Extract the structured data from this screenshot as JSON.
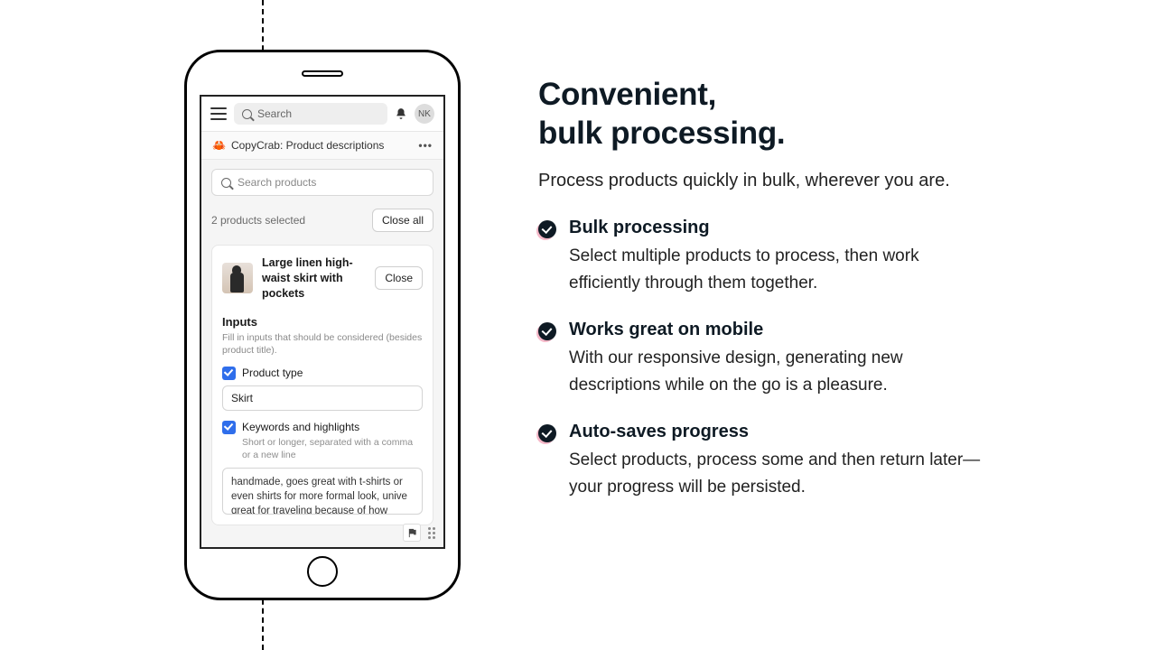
{
  "phone": {
    "topbar": {
      "search_placeholder": "Search",
      "avatar_initials": "NK"
    },
    "app_title": "CopyCrab: Product descriptions",
    "product_search_placeholder": "Search products",
    "selected_text": "2 products selected",
    "close_all_label": "Close all",
    "product": {
      "title": "Large linen high-waist skirt with pockets",
      "close_label": "Close"
    },
    "inputs_section": {
      "heading": "Inputs",
      "sub": "Fill in inputs that should be considered (besides product title)."
    },
    "product_type": {
      "label": "Product type",
      "value": "Skirt"
    },
    "keywords": {
      "label": "Keywords and highlights",
      "helper": "Short or longer, separated with a comma or a new line",
      "value": "handmade, goes great with t-shirts or even shirts for more formal look, unive great for traveling because of how"
    }
  },
  "marketing": {
    "heading_line1": "Convenient,",
    "heading_line2": "bulk processing.",
    "subheading": "Process products quickly in bulk, wherever you are.",
    "features": [
      {
        "title": "Bulk processing",
        "desc": "Select multiple products to process, then work efficiently through them together."
      },
      {
        "title": "Works great on mobile",
        "desc": "With our responsive design, generating new descriptions while on the go is a pleasure."
      },
      {
        "title": "Auto-saves progress",
        "desc": "Select products, process some and then return later—your progress will be persisted."
      }
    ]
  }
}
